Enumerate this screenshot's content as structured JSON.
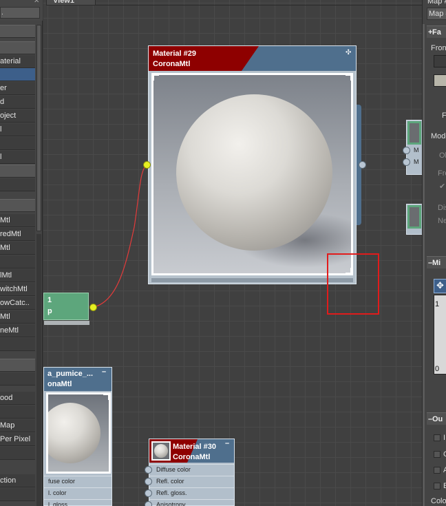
{
  "left_panel": {
    "search_value": ".",
    "items": [
      {
        "label": "",
        "style": "sec"
      },
      {
        "label": "",
        "style": "sec"
      },
      {
        "label": "aterial",
        "style": "item"
      },
      {
        "label": "",
        "style": "sel"
      },
      {
        "label": "er",
        "style": "item"
      },
      {
        "label": "d",
        "style": "item"
      },
      {
        "label": "oject",
        "style": "item"
      },
      {
        "label": "l",
        "style": "item"
      },
      {
        "label": "",
        "style": "item"
      },
      {
        "label": "l",
        "style": "item"
      },
      {
        "label": "",
        "style": "sec"
      },
      {
        "label": "",
        "style": "item"
      },
      {
        "label": "",
        "style": "sec"
      },
      {
        "label": "Mtl",
        "style": "item"
      },
      {
        "label": "redMtl",
        "style": "item"
      },
      {
        "label": "Mtl",
        "style": "item"
      },
      {
        "label": "",
        "style": "item"
      },
      {
        "label": "lMtl",
        "style": "item"
      },
      {
        "label": "witchMtl",
        "style": "item"
      },
      {
        "label": "owCatc..",
        "style": "item"
      },
      {
        "label": "Mtl",
        "style": "item"
      },
      {
        "label": "neMtl",
        "style": "item"
      },
      {
        "label": "",
        "style": "item"
      },
      {
        "label": "",
        "style": "sec"
      },
      {
        "label": "",
        "style": "item"
      },
      {
        "label": "ood",
        "style": "item"
      },
      {
        "label": "",
        "style": "item"
      },
      {
        "label": "Map",
        "style": "item"
      },
      {
        "label": " Per Pixel",
        "style": "item"
      },
      {
        "label": "",
        "style": "item"
      },
      {
        "label": "ction",
        "style": "item"
      },
      {
        "label": "",
        "style": "item"
      }
    ]
  },
  "view": {
    "tab_label": "View1",
    "node_material29": {
      "name": "Material #29",
      "type": "CoronaMtl"
    },
    "node_green": {
      "line1": "1",
      "line2": "p"
    },
    "node_pumice": {
      "name": "a_pumice_...",
      "type": "onaMtl",
      "slots": [
        "fuse color",
        "l. color",
        "l. gloss."
      ]
    },
    "node_material30": {
      "name": "Material #30",
      "type": "CoronaMtl",
      "slots": [
        "Diffuse color",
        "Refl. color",
        "Refl. gloss.",
        "Anisotropy"
      ]
    },
    "right_partial_node": {
      "slots": [
        "M",
        "M"
      ]
    }
  },
  "right_panel": {
    "title": "Map #",
    "map_field": "Map #",
    "section_falloff": "Fa",
    "front_label": "Fron",
    "f_label": "F",
    "mode_label": "Mode",
    "ob_label": "Ol",
    "fre_label": "Fre",
    "dis_label": "Dis",
    "ne_label": "Ne",
    "section_mix": "Mi",
    "curve_top": "1",
    "curve_bottom": "0",
    "section_output": "Ou",
    "output_checks": [
      "I",
      "C",
      "A",
      "E"
    ],
    "color_label": "Colo",
    "colors": {
      "swatch_dark": "#3c3c3c",
      "swatch_light": "#b8b6aa",
      "accent": "#3d5f8a"
    }
  }
}
